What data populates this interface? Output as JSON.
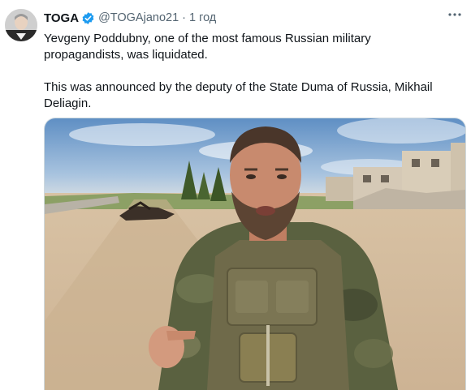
{
  "author": {
    "name": "TOGA",
    "handle": "@TOGAjano21",
    "separator": "·",
    "time": "1 год",
    "verified": true
  },
  "tweet": {
    "paragraphs": [
      "Yevgeny Poddubny, one of the most famous Russian military propagandists, was liquidated.",
      "This was announced by the deputy of the State Duma of Russia, Mikhail Deliagin."
    ]
  },
  "icons": {
    "verified": "verified-badge-icon",
    "more": "more-options-icon"
  },
  "colors": {
    "verified": "#1d9bf0",
    "secondary_text": "#536471",
    "primary_text": "#0f1419"
  }
}
